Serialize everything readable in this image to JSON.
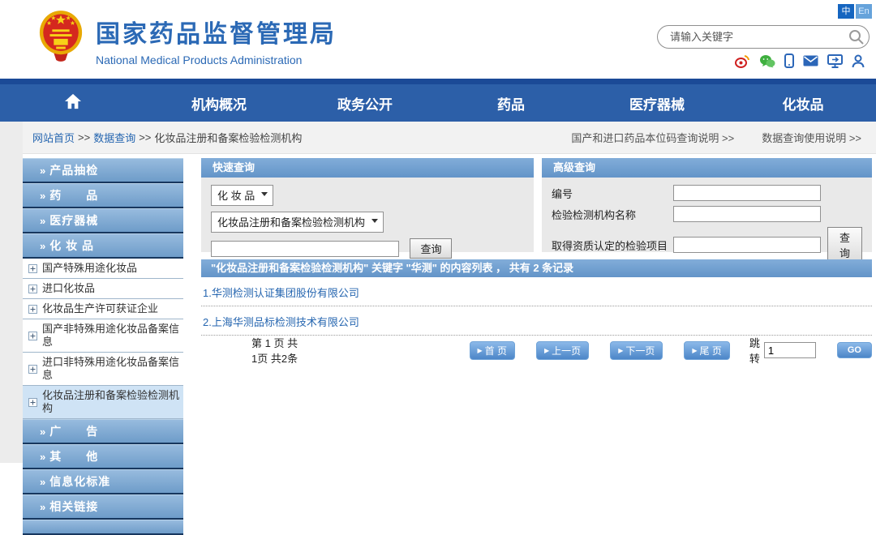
{
  "header": {
    "title": "国家药品监督管理局",
    "subtitle": "National Medical Products Administration",
    "lang_zh": "中",
    "lang_en": "En",
    "search_placeholder": "请输入关键字"
  },
  "nav": {
    "items": [
      "机构概况",
      "政务公开",
      "药品",
      "医疗器械",
      "化妆品"
    ]
  },
  "breadcrumb": {
    "home": "网站首页",
    "sep": ">>",
    "section": "数据查询",
    "current": "化妆品注册和备案检验检测机构",
    "right_link1": "国产和进口药品本位码查询说明 >>",
    "right_link2": "数据查询使用说明 >>"
  },
  "sidebar": {
    "items": [
      {
        "type": "cat",
        "label": "产品抽检"
      },
      {
        "type": "cat",
        "label": "药　　品"
      },
      {
        "type": "cat",
        "label": "医疗器械"
      },
      {
        "type": "cat",
        "label": "化 妆 品"
      },
      {
        "type": "sub",
        "label": "国产特殊用途化妆品"
      },
      {
        "type": "sub",
        "label": "进口化妆品"
      },
      {
        "type": "sub",
        "label": "化妆品生产许可获证企业"
      },
      {
        "type": "sub",
        "label": "国产非特殊用途化妆品备案信息"
      },
      {
        "type": "sub",
        "label": "进口非特殊用途化妆品备案信息"
      },
      {
        "type": "sub",
        "label": "化妆品注册和备案检验检测机构",
        "selected": true
      },
      {
        "type": "cat",
        "label": "广　　告"
      },
      {
        "type": "cat",
        "label": "其　　他"
      },
      {
        "type": "cat",
        "label": "信息化标准"
      },
      {
        "type": "cat",
        "label": "相关链接"
      }
    ]
  },
  "quick_search": {
    "title": "快速查询",
    "category_select": "化 妆 品",
    "type_select": "化妆品注册和备案检验检测机构",
    "keyword_value": "",
    "search_button": "查询"
  },
  "advanced_search": {
    "title": "高级查询",
    "fields": [
      {
        "label": "编号",
        "value": ""
      },
      {
        "label": "检验检测机构名称",
        "value": ""
      },
      {
        "label": "取得资质认定的检验项目",
        "value": ""
      }
    ],
    "search_button": "查询"
  },
  "results": {
    "header": "\"化妆品注册和备案检验检测机构\" 关键字 \"华测\" 的内容列表 ， 共有 2 条记录",
    "items": [
      "1.华测检测认证集团股份有限公司",
      "2.上海华测品标检测技术有限公司"
    ]
  },
  "pagination": {
    "info": "第 1 页 共1页 共2条",
    "arrow": "▶",
    "first": "首 页",
    "prev": "上一页",
    "next": "下一页",
    "last": "尾 页",
    "jump_label": "跳转",
    "jump_value": "1",
    "go": "GO"
  },
  "colors": {
    "nav_blue": "#2c5fa8",
    "panel_header_blue": "#6f9ecf",
    "link_blue": "#2666b0",
    "selected_item_bg": "#cfe3f5",
    "title_blue": "#2b69b5"
  }
}
